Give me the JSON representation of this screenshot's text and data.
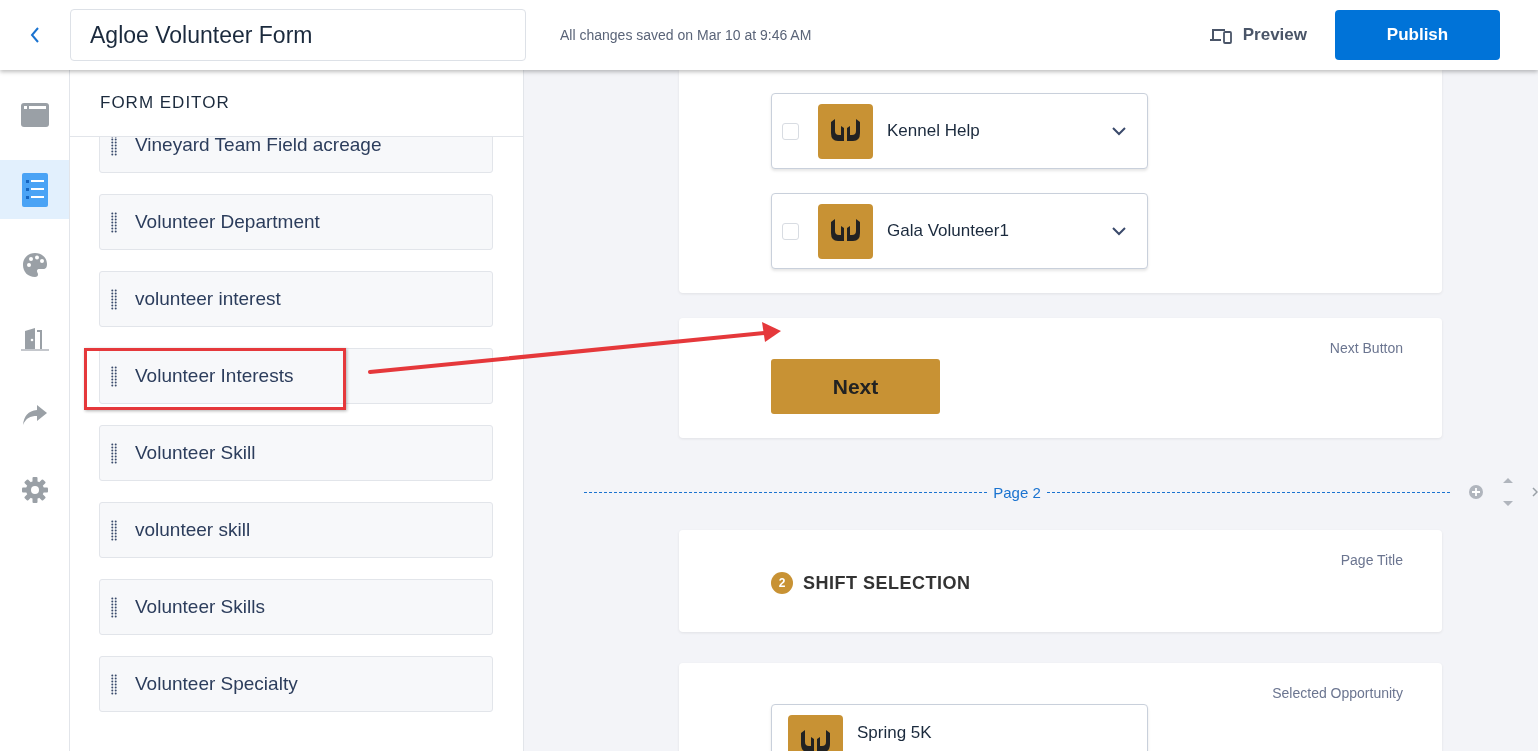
{
  "header": {
    "title": "Agloe Volunteer Form",
    "status": "All changes saved on Mar 10 at 9:46 AM",
    "preview": "Preview",
    "publish": "Publish"
  },
  "rail": [
    {
      "kind": "window",
      "selected": false
    },
    {
      "kind": "list",
      "selected": true
    },
    {
      "kind": "palette",
      "selected": false
    },
    {
      "kind": "door",
      "selected": false
    },
    {
      "kind": "share",
      "selected": false
    },
    {
      "kind": "gear",
      "selected": false
    }
  ],
  "panel": {
    "title": "FORM EDITOR",
    "fields": [
      {
        "label": "Vineyard Team Field acreage",
        "highlighted": false
      },
      {
        "label": "Volunteer Department",
        "highlighted": false
      },
      {
        "label": "volunteer interest",
        "highlighted": false
      },
      {
        "label": "Volunteer Interests",
        "highlighted": true
      },
      {
        "label": "Volunteer Skill",
        "highlighted": false
      },
      {
        "label": "volunteer skill",
        "highlighted": false
      },
      {
        "label": "Volunteer Skills",
        "highlighted": false
      },
      {
        "label": "Volunteer Specialty",
        "highlighted": false
      }
    ]
  },
  "canvas": {
    "opportunities": [
      {
        "name": "Kennel Help",
        "checked": false
      },
      {
        "name": "Gala Volunteer1",
        "checked": false
      }
    ],
    "next_card": {
      "label": "Next Button",
      "button": "Next"
    },
    "page_divider": "Page 2",
    "page_title_card": {
      "label": "Page Title",
      "number": "2",
      "title": "SHIFT SELECTION"
    },
    "selected_card": {
      "label": "Selected Opportunity",
      "items": [
        {
          "name": "Spring 5K"
        }
      ]
    }
  }
}
